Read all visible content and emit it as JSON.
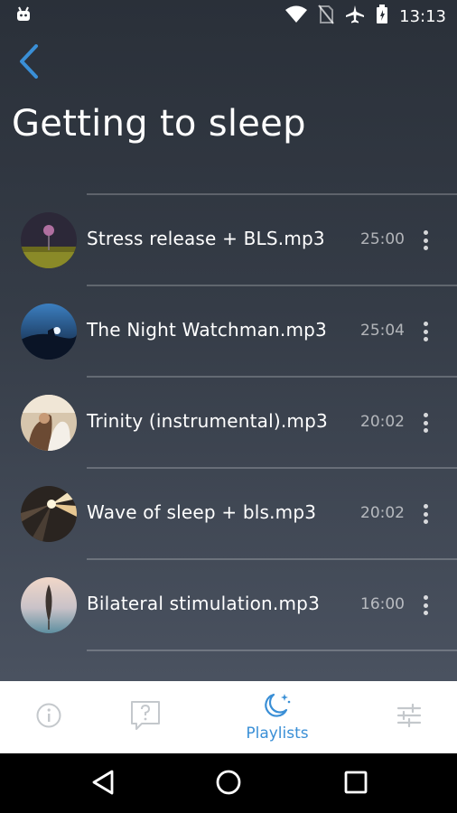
{
  "status_bar": {
    "time": "13:13"
  },
  "header": {
    "title": "Getting to sleep"
  },
  "tracks": [
    {
      "title": "Stress release + BLS.mp3",
      "duration": "25:00"
    },
    {
      "title": "The Night Watchman.mp3",
      "duration": "25:04"
    },
    {
      "title": "Trinity (instrumental).mp3",
      "duration": "20:02"
    },
    {
      "title": "Wave of sleep + bls.mp3",
      "duration": "20:02"
    },
    {
      "title": "Bilateral stimulation.mp3",
      "duration": "16:00"
    }
  ],
  "bottom_nav": {
    "items": [
      {
        "icon": "info-icon"
      },
      {
        "icon": "help-icon"
      },
      {
        "icon": "moon-stars-icon",
        "label": "Playlists",
        "active": true
      },
      {
        "icon": "sliders-icon"
      }
    ]
  },
  "colors": {
    "accent": "#3a8fd6",
    "background_top": "#2a3039",
    "background_bottom": "#4a5260"
  }
}
